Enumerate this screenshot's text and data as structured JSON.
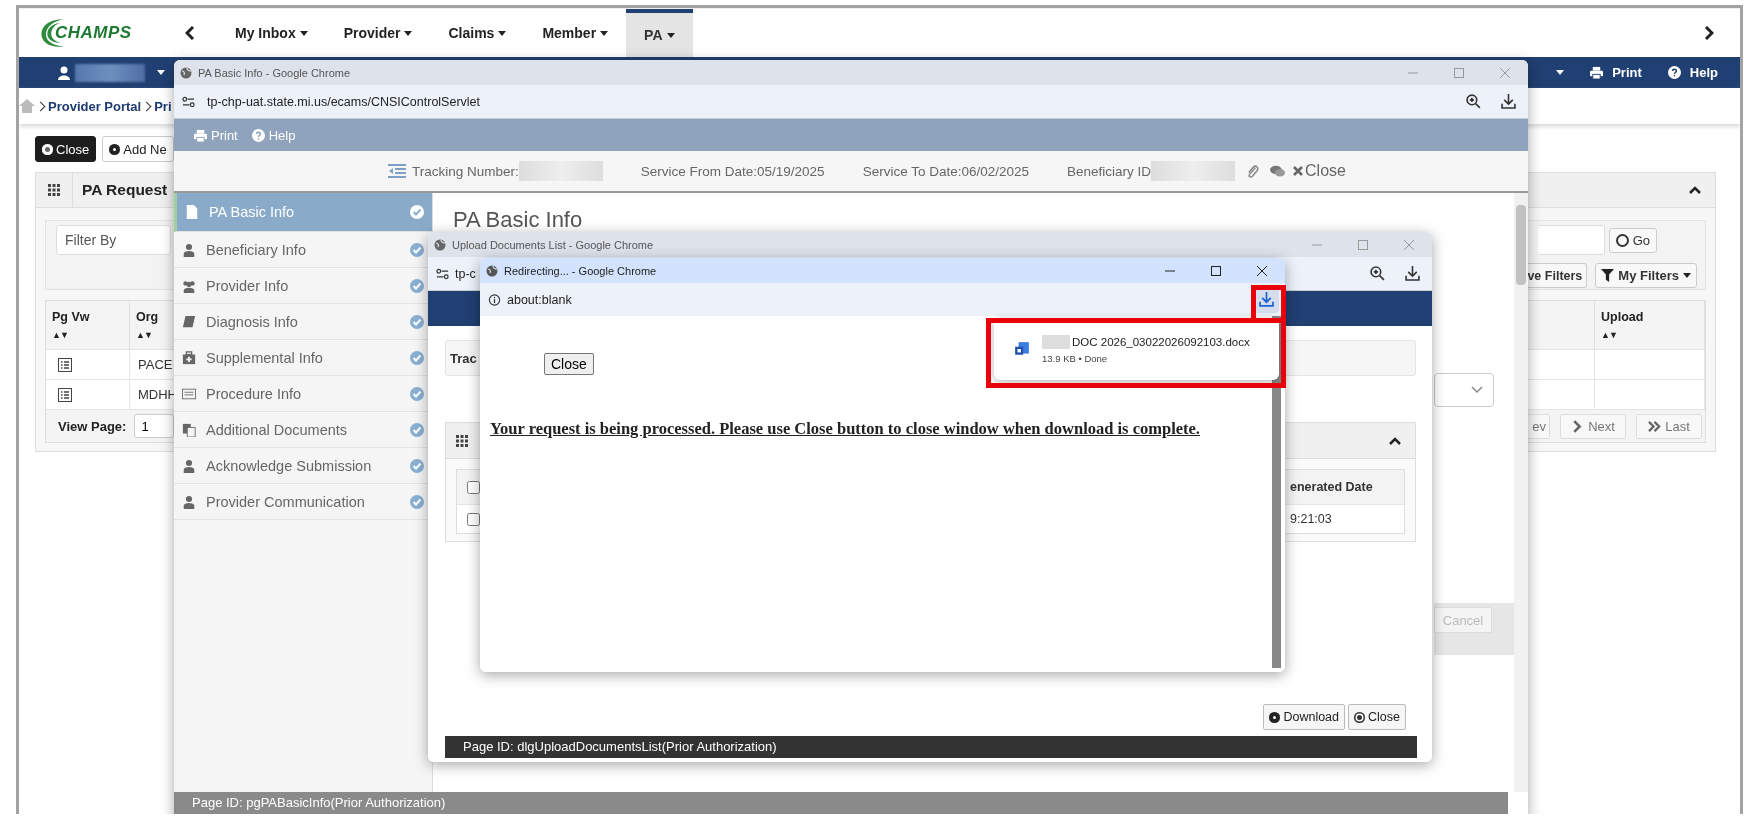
{
  "header": {
    "logo": "CHAMPS",
    "nav": [
      {
        "label": "My Inbox",
        "selected": false
      },
      {
        "label": "Provider",
        "selected": false
      },
      {
        "label": "Claims",
        "selected": false
      },
      {
        "label": "Member",
        "selected": false
      },
      {
        "label": "PA",
        "selected": true
      }
    ]
  },
  "user_bar": {
    "links": [
      {
        "kind": "print",
        "label": "Print"
      },
      {
        "kind": "help",
        "label": "Help"
      }
    ]
  },
  "breadcrumb": [
    "Provider Portal",
    "Pri"
  ],
  "toolbar": [
    {
      "kind": "close",
      "label": "Close"
    },
    {
      "kind": "add",
      "label": "Add Ne"
    }
  ],
  "pa_request": {
    "title": "PA Request",
    "filter": {
      "placeholder": "Filter By"
    },
    "go": "Go",
    "filter_buttons": [
      {
        "kind": "plain",
        "label": "ve Filters"
      },
      {
        "kind": "filter",
        "label": "My Filters"
      }
    ],
    "columns": [
      {
        "label": "Pg Vw",
        "sort": "▲▼"
      },
      {
        "label": "Org",
        "sort": "▲▼"
      },
      {
        "label": "Upload",
        "sort": "▲▼"
      }
    ],
    "rows": [
      {
        "org": "PACE"
      },
      {
        "org": "MDHH"
      }
    ],
    "pager": {
      "label": "View Page:",
      "page": "1",
      "buttons": [
        {
          "kind": "plain",
          "label": "ev"
        },
        {
          "kind": "next",
          "label": "Next"
        },
        {
          "kind": "last",
          "label": "Last"
        }
      ]
    }
  },
  "pa_window": {
    "title": "PA Basic Info - Google Chrome",
    "url": "tp-chp-uat.state.mi.us/ecams/CNSIControlServlet",
    "toolbar": [
      {
        "kind": "print",
        "label": "Print"
      },
      {
        "kind": "help",
        "label": "Help"
      }
    ],
    "info": {
      "tracking": "Tracking Number:",
      "from": "Service From Date:05/19/2025",
      "to": "Service To Date:06/02/2025",
      "beneficiary": "Beneficiary ID",
      "close": "Close"
    },
    "sidebar": [
      {
        "kind": "file",
        "label": "PA Basic Info",
        "selected": true,
        "checked": true
      },
      {
        "kind": "person",
        "label": "Beneficiary Info",
        "selected": false,
        "checked": true
      },
      {
        "kind": "group",
        "label": "Provider Info",
        "selected": false,
        "checked": true
      },
      {
        "kind": "book",
        "label": "Diagnosis Info",
        "selected": false,
        "checked": true
      },
      {
        "kind": "medkit",
        "label": "Supplemental Info",
        "selected": false,
        "checked": true
      },
      {
        "kind": "list",
        "label": "Procedure Info",
        "selected": false,
        "checked": true
      },
      {
        "kind": "docs",
        "label": "Additional Documents",
        "selected": false,
        "checked": true
      },
      {
        "kind": "person",
        "label": "Acknowledge Submission",
        "selected": false,
        "checked": true
      },
      {
        "kind": "person",
        "label": "Provider Communication",
        "selected": false,
        "checked": true
      }
    ],
    "heading": "PA Basic Info",
    "cancel": "Cancel",
    "page_id": "Page ID: pgPABasicInfo(Prior Authorization)"
  },
  "upload_window": {
    "title": "Upload Documents List - Google Chrome",
    "url": "tp-c",
    "section_label": "Trac",
    "column": "enerated Date",
    "rows": [
      {
        "checked": false,
        "value": ""
      },
      {
        "checked": false,
        "value": "9:21:03"
      }
    ],
    "buttons": [
      {
        "kind": "download",
        "label": "Download"
      },
      {
        "kind": "close",
        "label": "Close"
      }
    ],
    "page_id": "Page ID: dlgUploadDocumentsList(Prior Authorization)"
  },
  "redirect_window": {
    "title": "Redirecting... - Google Chrome",
    "url": "about:blank",
    "close": "Close",
    "message": "Your request is being processed. Please use Close button to close window when download is complete.",
    "download": {
      "file": "DOC 2026_03022026092103.docx",
      "meta": "13.9 KB • Done"
    }
  }
}
